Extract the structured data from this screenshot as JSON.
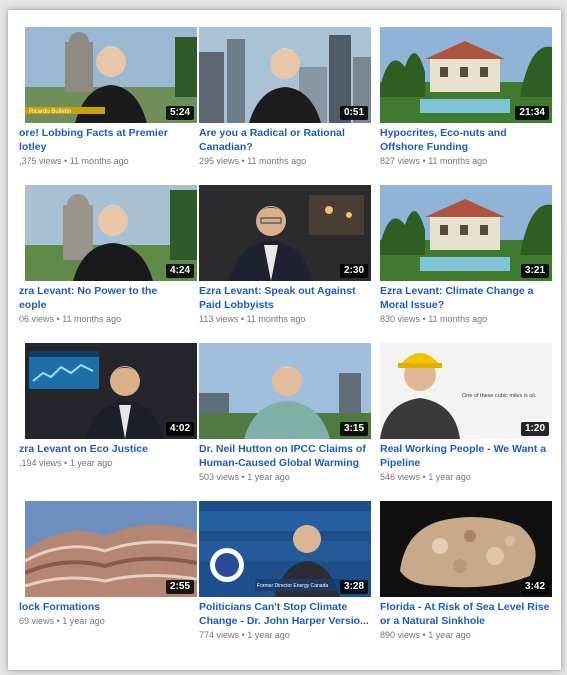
{
  "videos": [
    {
      "title_1": "ore! Lobbing Facts at Premier",
      "title_2": "lotley",
      "views": ",375 views",
      "age": "11 months ago",
      "duration": "5:24"
    },
    {
      "title_1": "Are you a Radical or Rational",
      "title_2": "Canadian?",
      "views": "295 views",
      "age": "11 months ago",
      "duration": "0:51"
    },
    {
      "title_1": "Hypocrites, Eco-nuts and",
      "title_2": "Offshore Funding",
      "views": "827 views",
      "age": "11 months ago",
      "duration": "21:34"
    },
    {
      "title_1": "zra Levant: No Power to the",
      "title_2": "eople",
      "views": "06 views",
      "age": "11 months ago",
      "duration": "4:24"
    },
    {
      "title_1": "Ezra Levant: Speak out Against",
      "title_2": "Paid Lobbyists",
      "views": "113 views",
      "age": "11 months ago",
      "duration": "2:30"
    },
    {
      "title_1": "Ezra Levant: Climate Change a",
      "title_2": "Moral Issue?",
      "views": "830 views",
      "age": "11 months ago",
      "duration": "3:21"
    },
    {
      "title_1": "zra Levant on Eco Justice",
      "title_2": "",
      "views": ",194 views",
      "age": "1 year ago",
      "duration": "4:02"
    },
    {
      "title_1": "Dr. Neil Hutton on IPCC Claims of",
      "title_2": "Human-Caused Global Warming",
      "views": "503 views",
      "age": "1 year ago",
      "duration": "3:15"
    },
    {
      "title_1": "Real Working People - We Want a",
      "title_2": "Pipeline",
      "views": "546 views",
      "age": "1 year ago",
      "duration": "1:20"
    },
    {
      "title_1": "lock Formations",
      "title_2": "",
      "views": "69 views",
      "age": "1 year ago",
      "duration": "2:55"
    },
    {
      "title_1": "Politicians Can't Stop Climate",
      "title_2": "Change - Dr. John Harper Versio...",
      "views": "774 views",
      "age": "1 year ago",
      "duration": "3:28"
    },
    {
      "title_1": "Florida - At Risk of Sea Level Rise",
      "title_2": "or a Natural Sinkhole",
      "views": "890 views",
      "age": "1 year ago",
      "duration": "3:42"
    }
  ],
  "separator": "•",
  "thumb_text": {
    "ticker_1": "Ricardo Bulletin",
    "caption_9": "One of these cubic miles is oil.",
    "caption_11": "Former Director Energy Canada"
  }
}
